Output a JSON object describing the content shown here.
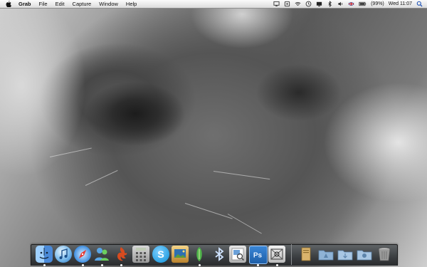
{
  "menubar": {
    "app_name": "Grab",
    "menus": [
      "File",
      "Edit",
      "Capture",
      "Window",
      "Help"
    ],
    "battery_percent": "(99%)",
    "clock": "Wed 11:07"
  },
  "dock": {
    "items": [
      {
        "name": "finder-icon",
        "running": true
      },
      {
        "name": "itunes-icon",
        "running": false
      },
      {
        "name": "safari-icon",
        "running": true
      },
      {
        "name": "messenger-icon",
        "running": true
      },
      {
        "name": "firefox-icon",
        "running": true
      },
      {
        "name": "calculator-icon",
        "running": false
      },
      {
        "name": "skype-icon",
        "running": false
      },
      {
        "name": "iphoto-icon",
        "running": false
      },
      {
        "name": "adium-icon",
        "running": true
      },
      {
        "name": "bluetooth-icon",
        "running": false
      },
      {
        "name": "preview-icon",
        "running": false
      },
      {
        "name": "photoshop-icon",
        "running": true
      },
      {
        "name": "grab-icon",
        "running": true
      },
      {
        "name": "documents-stack-icon",
        "running": false
      },
      {
        "name": "applications-folder-icon",
        "running": false
      },
      {
        "name": "downloads-folder-icon",
        "running": false
      },
      {
        "name": "shared-folder-icon",
        "running": false
      },
      {
        "name": "trash-icon",
        "running": false
      }
    ],
    "colors": {
      "finder": "#4a8ad9",
      "itunes": "#6fb3e8",
      "safari": "#3e8ee0",
      "messenger": "#59a6e6",
      "firefox": "#d84b1f",
      "photoshop": "#1e5fa8",
      "folder": "#8fb3d6"
    }
  }
}
